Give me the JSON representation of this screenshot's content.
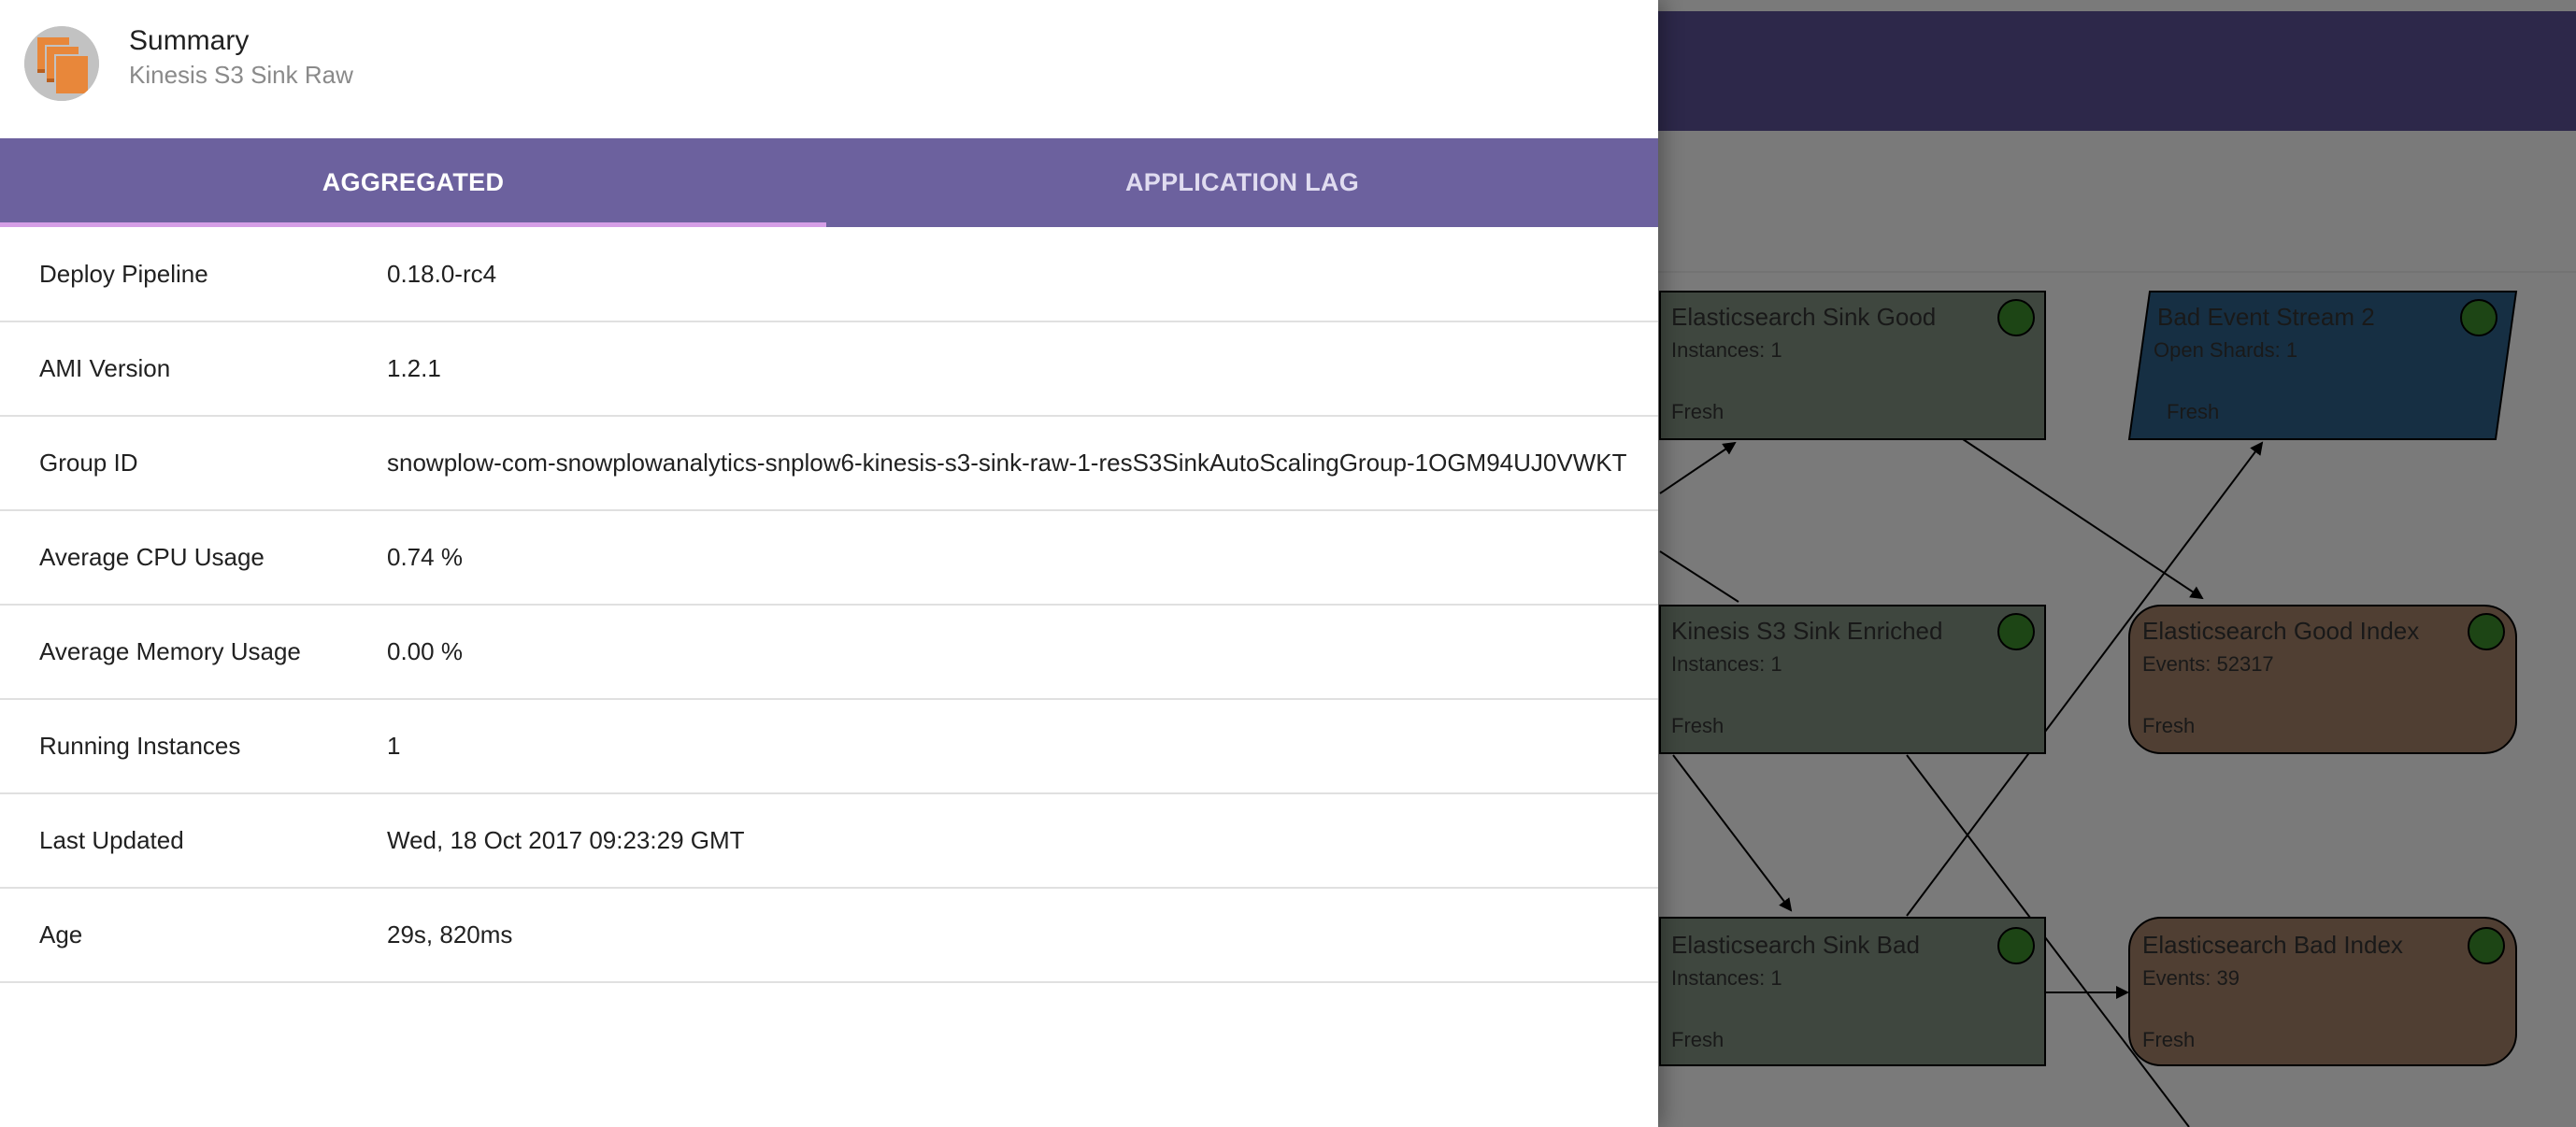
{
  "background": {
    "nodes": [
      {
        "id": "es-sink-good",
        "title": "Elasticsearch Sink Good",
        "line1": "Instances: 1",
        "status": "Fresh",
        "shape": "rect",
        "color": "#7e8e7e"
      },
      {
        "id": "bad-event-stream-2",
        "title": "Bad Event Stream 2",
        "line1": "Open Shards: 1",
        "status": "Fresh",
        "shape": "parallelogram",
        "color": "#2d5f86"
      },
      {
        "id": "kinesis-s3-sink-enriched",
        "title": "Kinesis S3 Sink Enriched",
        "line1": "Instances: 1",
        "status": "Fresh",
        "shape": "rect",
        "color": "#7e8e7e"
      },
      {
        "id": "es-good-index",
        "title": "Elasticsearch Good Index",
        "line1": "Events: 52317",
        "status": "Fresh",
        "shape": "rounded",
        "color": "#a07e66"
      },
      {
        "id": "es-sink-bad",
        "title": "Elasticsearch Sink Bad",
        "line1": "Instances: 1",
        "status": "Fresh",
        "shape": "rect",
        "color": "#7e8e7e"
      },
      {
        "id": "es-bad-index",
        "title": "Elasticsearch Bad Index",
        "line1": "Events: 39",
        "status": "Fresh",
        "shape": "rounded",
        "color": "#a07e66"
      }
    ],
    "status_color": "#3a8a2a"
  },
  "drawer": {
    "title": "Summary",
    "subtitle": "Kinesis S3 Sink Raw",
    "avatar_icon": "aws-autoscaling-icon",
    "tabs": [
      {
        "label": "AGGREGATED",
        "active": true
      },
      {
        "label": "APPLICATION LAG",
        "active": false
      }
    ],
    "rows": [
      {
        "key": "Deploy Pipeline",
        "value": "0.18.0-rc4"
      },
      {
        "key": "AMI Version",
        "value": "1.2.1"
      },
      {
        "key": "Group ID",
        "value": "snowplow-com-snowplowanalytics-snplow6-kinesis-s3-sink-raw-1-resS3SinkAutoScalingGroup-1OGM94UJ0VWKT"
      },
      {
        "key": "Average CPU Usage",
        "value": "0.74 %"
      },
      {
        "key": "Average Memory Usage",
        "value": "0.00 %"
      },
      {
        "key": "Running Instances",
        "value": "1"
      },
      {
        "key": "Last Updated",
        "value": "Wed, 18 Oct 2017 09:23:29 GMT"
      },
      {
        "key": "Age",
        "value": "29s, 820ms"
      }
    ]
  }
}
